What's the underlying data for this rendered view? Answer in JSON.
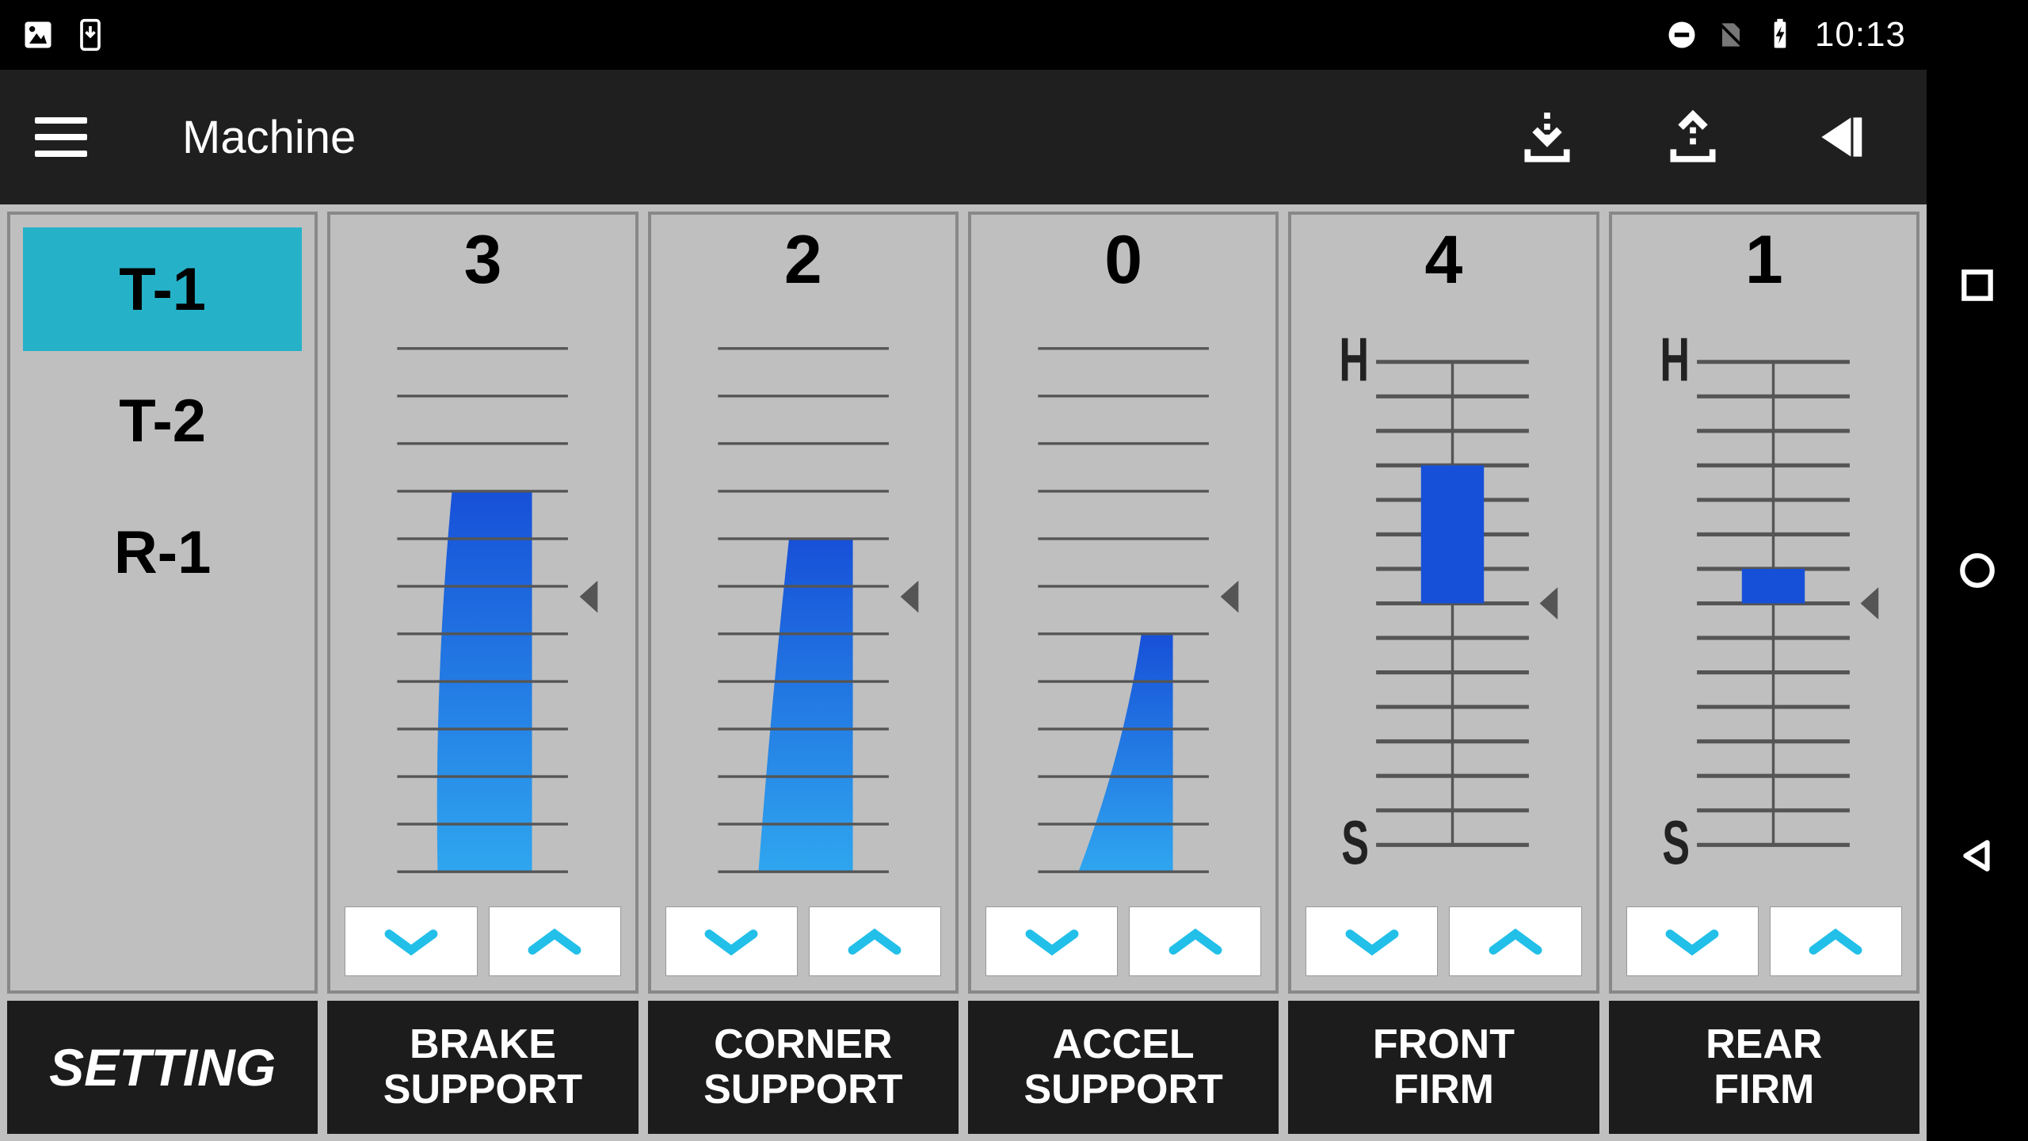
{
  "status": {
    "clock": "10:13"
  },
  "appbar": {
    "title": "Machine"
  },
  "tabs": [
    {
      "label": "T-1",
      "selected": true
    },
    {
      "label": "T-2",
      "selected": false
    },
    {
      "label": "R-1",
      "selected": false
    }
  ],
  "gauges": [
    {
      "id": "brake",
      "label1": "BRAKE",
      "label2": "SUPPORT",
      "type": "curve",
      "value": 3,
      "max": 6
    },
    {
      "id": "corner",
      "label1": "CORNER",
      "label2": "SUPPORT",
      "type": "curve",
      "value": 2,
      "max": 6
    },
    {
      "id": "accel",
      "label1": "ACCEL",
      "label2": "SUPPORT",
      "type": "curve",
      "value": 0,
      "max": 6
    },
    {
      "id": "front",
      "label1": "FRONT",
      "label2": "FIRM",
      "type": "firm",
      "value": 4,
      "max": 7,
      "hi": "H",
      "lo": "S"
    },
    {
      "id": "rear",
      "label1": "REAR",
      "label2": "FIRM",
      "type": "firm",
      "value": 1,
      "max": 7,
      "hi": "H",
      "lo": "S"
    }
  ],
  "footer": {
    "setting": "SETTING"
  },
  "colors": {
    "accent": "#25b2c9",
    "grad_top": "#1750d8",
    "grad_bot": "#2fa6ef",
    "chevron": "#22bfe8"
  }
}
